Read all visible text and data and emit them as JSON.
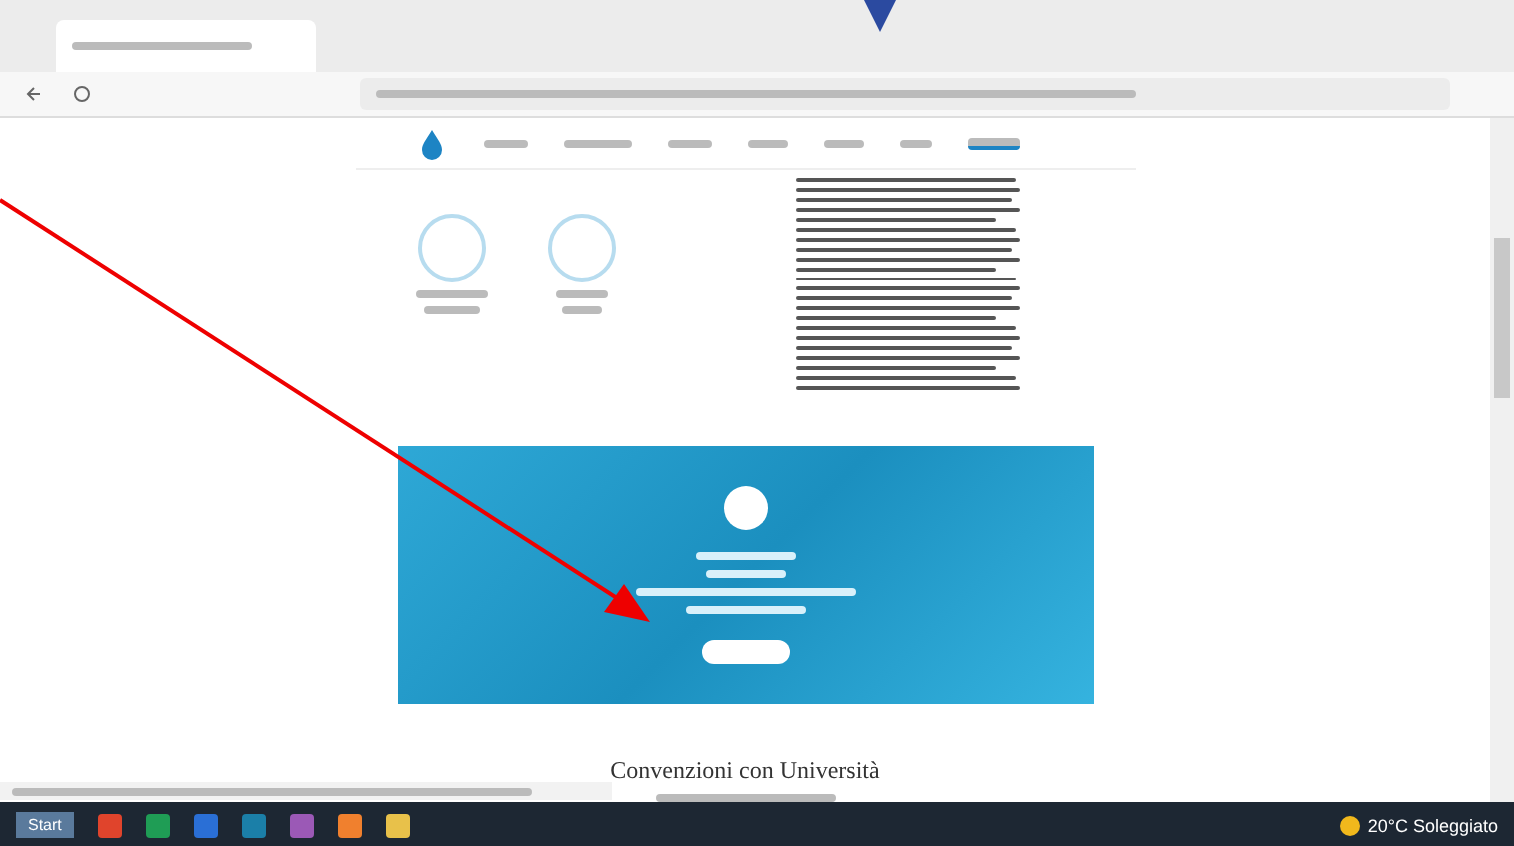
{
  "page": {
    "heading": "Convenzioni con Università"
  },
  "taskbar": {
    "start": "Start",
    "weather": "20°C Soleggiato"
  }
}
